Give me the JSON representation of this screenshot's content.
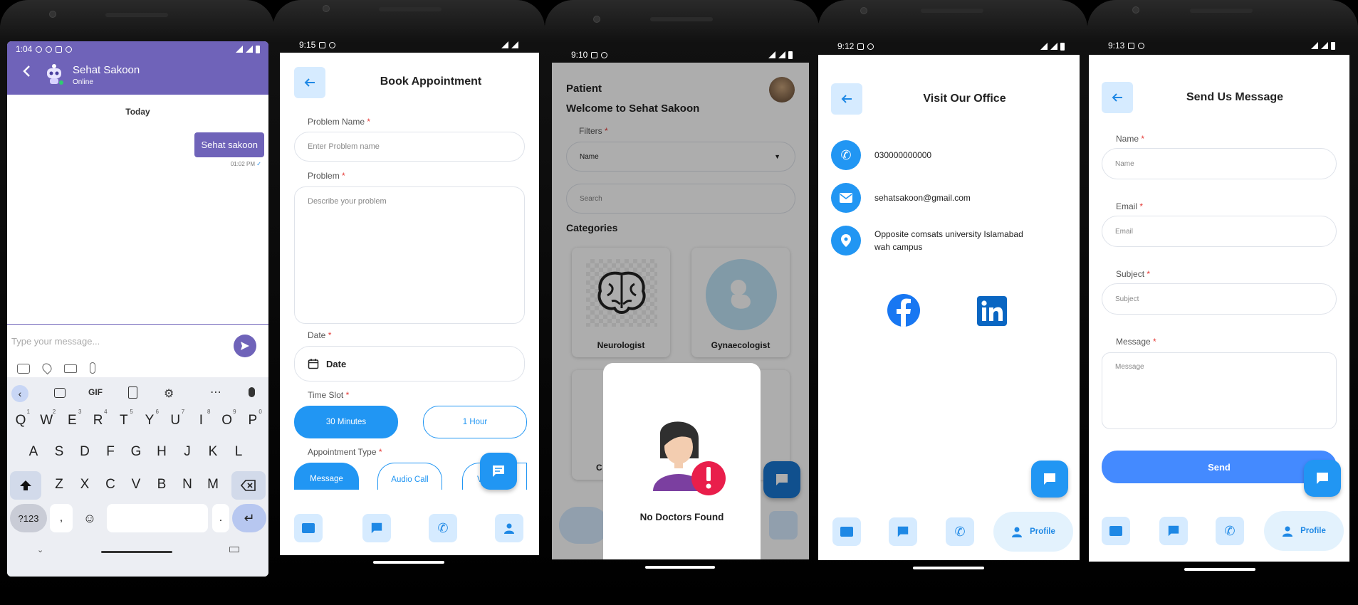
{
  "chat": {
    "time": "1:04",
    "contact_name": "Sehat Sakoon",
    "status": "Online",
    "date_divider": "Today",
    "message_text": "Sehat sakoon",
    "message_time": "01:02 PM",
    "input_placeholder": "Type your message...",
    "keyboard": {
      "gif": "GIF",
      "row1": [
        "Q",
        "W",
        "E",
        "R",
        "T",
        "Y",
        "U",
        "I",
        "O",
        "P"
      ],
      "row1_nums": [
        "1",
        "2",
        "3",
        "4",
        "5",
        "6",
        "7",
        "8",
        "9",
        "0"
      ],
      "row2": [
        "A",
        "S",
        "D",
        "F",
        "G",
        "H",
        "J",
        "K",
        "L"
      ],
      "row3": [
        "Z",
        "X",
        "C",
        "V",
        "B",
        "N",
        "M"
      ],
      "sym": "?123",
      "comma": ",",
      "period": "."
    }
  },
  "book": {
    "time": "9:15",
    "title": "Book Appointment",
    "problem_name_label": "Problem Name",
    "problem_name_placeholder": "Enter Problem name",
    "problem_label": "Problem",
    "problem_placeholder": "Describe your problem",
    "date_label": "Date",
    "date_value": "Date",
    "timeslot_label": "Time Slot",
    "slot_30": "30 Minutes",
    "slot_60": "1 Hour",
    "type_label": "Appointment Type",
    "type_message": "Message",
    "type_audio": "Audio Call",
    "type_video": "Vide",
    "required": "*"
  },
  "home": {
    "time": "9:10",
    "role": "Patient",
    "welcome": "Welcome to Sehat Sakoon",
    "filters_label": "Filters",
    "filter_value": "Name",
    "search_placeholder": "Search",
    "categories_label": "Categories",
    "cat1": "Neurologist",
    "cat2": "Gynaecologist",
    "cat3_partial": "C",
    "dialog_text": "No Doctors Found"
  },
  "office": {
    "time": "9:12",
    "title": "Visit Our Office",
    "phone": "030000000000",
    "email": "sehatsakoon@gmail.com",
    "address_line1": "Opposite comsats university Islamabad",
    "address_line2": "wah campus",
    "profile_label": "Profile"
  },
  "message": {
    "time": "9:13",
    "title": "Send Us Message",
    "name_label": "Name",
    "name_placeholder": "Name",
    "email_label": "Email",
    "email_placeholder": "Email",
    "subject_label": "Subject",
    "subject_placeholder": "Subject",
    "message_label": "Message",
    "message_placeholder": "Message",
    "send_label": "Send",
    "profile_label": "Profile"
  },
  "colors": {
    "chat_header": "#6f63b9",
    "primary_blue": "#2196f3",
    "light_blue": "#d6ebff",
    "error_red": "#e53935"
  }
}
